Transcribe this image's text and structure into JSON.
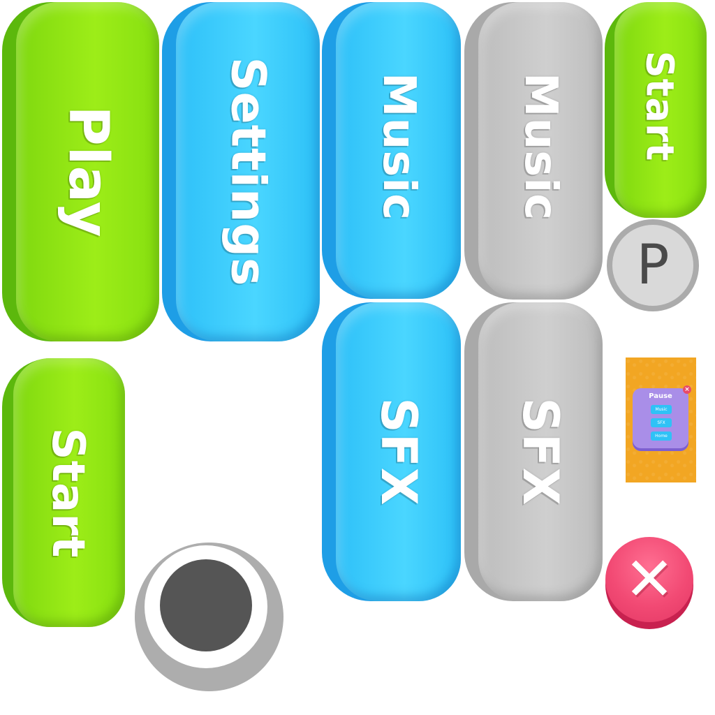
{
  "buttons": {
    "play": "Play",
    "settings": "Settings",
    "music_on": "Music",
    "music_off": "Music",
    "start_small": "Start",
    "start_large": "Start",
    "sfx_on": "SFX",
    "sfx_off": "SFX"
  },
  "badges": {
    "p_letter": "P",
    "close_glyph": "✕"
  },
  "pause_panel": {
    "title": "Pause",
    "close_glyph": "×",
    "buttons": [
      "Music",
      "SFX",
      "Home"
    ]
  },
  "colors": {
    "green": "#8fe212",
    "blue": "#35c8fb",
    "gray": "#c4c4c4",
    "red": "#f04a72",
    "orange": "#f2a623",
    "purple": "#a98ee8"
  },
  "icons": [
    "p-badge-icon",
    "close-icon",
    "toggle-knob-icon"
  ]
}
